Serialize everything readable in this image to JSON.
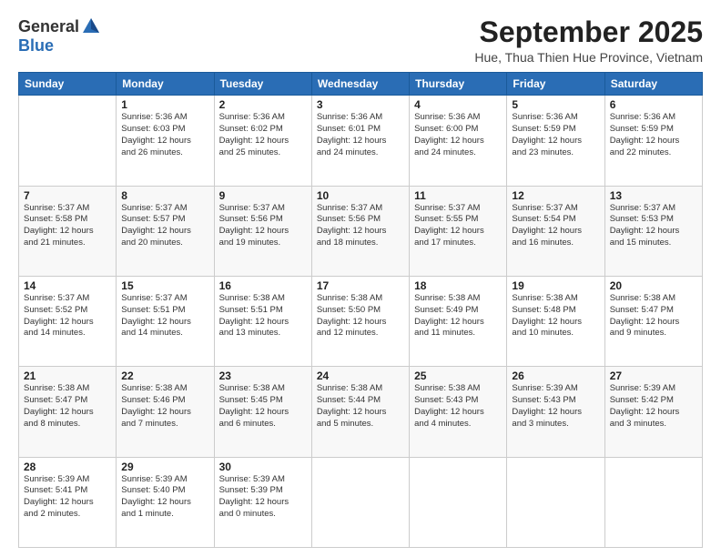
{
  "header": {
    "logo_general": "General",
    "logo_blue": "Blue",
    "month_title": "September 2025",
    "subtitle": "Hue, Thua Thien Hue Province, Vietnam"
  },
  "weekdays": [
    "Sunday",
    "Monday",
    "Tuesday",
    "Wednesday",
    "Thursday",
    "Friday",
    "Saturday"
  ],
  "weeks": [
    [
      {
        "day": "",
        "info": ""
      },
      {
        "day": "1",
        "info": "Sunrise: 5:36 AM\nSunset: 6:03 PM\nDaylight: 12 hours\nand 26 minutes."
      },
      {
        "day": "2",
        "info": "Sunrise: 5:36 AM\nSunset: 6:02 PM\nDaylight: 12 hours\nand 25 minutes."
      },
      {
        "day": "3",
        "info": "Sunrise: 5:36 AM\nSunset: 6:01 PM\nDaylight: 12 hours\nand 24 minutes."
      },
      {
        "day": "4",
        "info": "Sunrise: 5:36 AM\nSunset: 6:00 PM\nDaylight: 12 hours\nand 24 minutes."
      },
      {
        "day": "5",
        "info": "Sunrise: 5:36 AM\nSunset: 5:59 PM\nDaylight: 12 hours\nand 23 minutes."
      },
      {
        "day": "6",
        "info": "Sunrise: 5:36 AM\nSunset: 5:59 PM\nDaylight: 12 hours\nand 22 minutes."
      }
    ],
    [
      {
        "day": "7",
        "info": "Sunrise: 5:37 AM\nSunset: 5:58 PM\nDaylight: 12 hours\nand 21 minutes."
      },
      {
        "day": "8",
        "info": "Sunrise: 5:37 AM\nSunset: 5:57 PM\nDaylight: 12 hours\nand 20 minutes."
      },
      {
        "day": "9",
        "info": "Sunrise: 5:37 AM\nSunset: 5:56 PM\nDaylight: 12 hours\nand 19 minutes."
      },
      {
        "day": "10",
        "info": "Sunrise: 5:37 AM\nSunset: 5:56 PM\nDaylight: 12 hours\nand 18 minutes."
      },
      {
        "day": "11",
        "info": "Sunrise: 5:37 AM\nSunset: 5:55 PM\nDaylight: 12 hours\nand 17 minutes."
      },
      {
        "day": "12",
        "info": "Sunrise: 5:37 AM\nSunset: 5:54 PM\nDaylight: 12 hours\nand 16 minutes."
      },
      {
        "day": "13",
        "info": "Sunrise: 5:37 AM\nSunset: 5:53 PM\nDaylight: 12 hours\nand 15 minutes."
      }
    ],
    [
      {
        "day": "14",
        "info": "Sunrise: 5:37 AM\nSunset: 5:52 PM\nDaylight: 12 hours\nand 14 minutes."
      },
      {
        "day": "15",
        "info": "Sunrise: 5:37 AM\nSunset: 5:51 PM\nDaylight: 12 hours\nand 14 minutes."
      },
      {
        "day": "16",
        "info": "Sunrise: 5:38 AM\nSunset: 5:51 PM\nDaylight: 12 hours\nand 13 minutes."
      },
      {
        "day": "17",
        "info": "Sunrise: 5:38 AM\nSunset: 5:50 PM\nDaylight: 12 hours\nand 12 minutes."
      },
      {
        "day": "18",
        "info": "Sunrise: 5:38 AM\nSunset: 5:49 PM\nDaylight: 12 hours\nand 11 minutes."
      },
      {
        "day": "19",
        "info": "Sunrise: 5:38 AM\nSunset: 5:48 PM\nDaylight: 12 hours\nand 10 minutes."
      },
      {
        "day": "20",
        "info": "Sunrise: 5:38 AM\nSunset: 5:47 PM\nDaylight: 12 hours\nand 9 minutes."
      }
    ],
    [
      {
        "day": "21",
        "info": "Sunrise: 5:38 AM\nSunset: 5:47 PM\nDaylight: 12 hours\nand 8 minutes."
      },
      {
        "day": "22",
        "info": "Sunrise: 5:38 AM\nSunset: 5:46 PM\nDaylight: 12 hours\nand 7 minutes."
      },
      {
        "day": "23",
        "info": "Sunrise: 5:38 AM\nSunset: 5:45 PM\nDaylight: 12 hours\nand 6 minutes."
      },
      {
        "day": "24",
        "info": "Sunrise: 5:38 AM\nSunset: 5:44 PM\nDaylight: 12 hours\nand 5 minutes."
      },
      {
        "day": "25",
        "info": "Sunrise: 5:38 AM\nSunset: 5:43 PM\nDaylight: 12 hours\nand 4 minutes."
      },
      {
        "day": "26",
        "info": "Sunrise: 5:39 AM\nSunset: 5:43 PM\nDaylight: 12 hours\nand 3 minutes."
      },
      {
        "day": "27",
        "info": "Sunrise: 5:39 AM\nSunset: 5:42 PM\nDaylight: 12 hours\nand 3 minutes."
      }
    ],
    [
      {
        "day": "28",
        "info": "Sunrise: 5:39 AM\nSunset: 5:41 PM\nDaylight: 12 hours\nand 2 minutes."
      },
      {
        "day": "29",
        "info": "Sunrise: 5:39 AM\nSunset: 5:40 PM\nDaylight: 12 hours\nand 1 minute."
      },
      {
        "day": "30",
        "info": "Sunrise: 5:39 AM\nSunset: 5:39 PM\nDaylight: 12 hours\nand 0 minutes."
      },
      {
        "day": "",
        "info": ""
      },
      {
        "day": "",
        "info": ""
      },
      {
        "day": "",
        "info": ""
      },
      {
        "day": "",
        "info": ""
      }
    ]
  ]
}
